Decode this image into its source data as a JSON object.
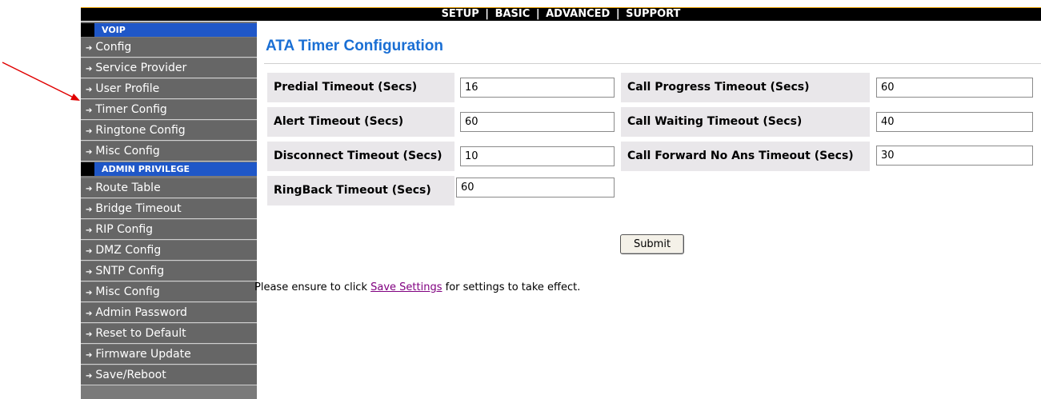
{
  "topnav": {
    "setup": "SETUP",
    "basic": "BASIC",
    "advanced": "ADVANCED",
    "support": "SUPPORT",
    "separator": "|"
  },
  "sidebar": {
    "voip_header": "VOIP",
    "voip_items": [
      {
        "label": "Config"
      },
      {
        "label": "Service Provider"
      },
      {
        "label": "User Profile"
      },
      {
        "label": "Timer Config"
      },
      {
        "label": "Ringtone Config"
      },
      {
        "label": "Misc Config"
      }
    ],
    "admin_header": "ADMIN PRIVILEGE",
    "admin_items": [
      {
        "label": "Route Table"
      },
      {
        "label": "Bridge Timeout"
      },
      {
        "label": "RIP Config"
      },
      {
        "label": "DMZ Config"
      },
      {
        "label": "SNTP Config"
      },
      {
        "label": "Misc Config"
      },
      {
        "label": "Admin Password"
      },
      {
        "label": "Reset to Default"
      },
      {
        "label": "Firmware Update"
      },
      {
        "label": "Save/Reboot"
      }
    ]
  },
  "main": {
    "title": "ATA Timer Configuration",
    "fields": {
      "predial": {
        "label": "Predial Timeout (Secs)",
        "value": "16"
      },
      "alert": {
        "label": "Alert Timeout (Secs)",
        "value": "60"
      },
      "disconnect": {
        "label": "Disconnect Timeout (Secs)",
        "value": "10"
      },
      "ringback": {
        "label": "RingBack Timeout (Secs)",
        "value": "60"
      },
      "call_progress": {
        "label": "Call Progress Timeout (Secs)",
        "value": "60"
      },
      "call_waiting": {
        "label": "Call Waiting Timeout (Secs)",
        "value": "40"
      },
      "call_forward": {
        "label": "Call Forward No Ans Timeout (Secs)",
        "value": "30"
      }
    },
    "submit_label": "Submit",
    "note_prefix": "Please ensure to click ",
    "note_link": "Save Settings",
    "note_suffix": " for settings to take effect."
  },
  "colors": {
    "title": "#1a6fd4",
    "sidebar_header": "#1f57c8",
    "sidebar_item": "#666666",
    "annotation_arrow": "#e00000"
  }
}
